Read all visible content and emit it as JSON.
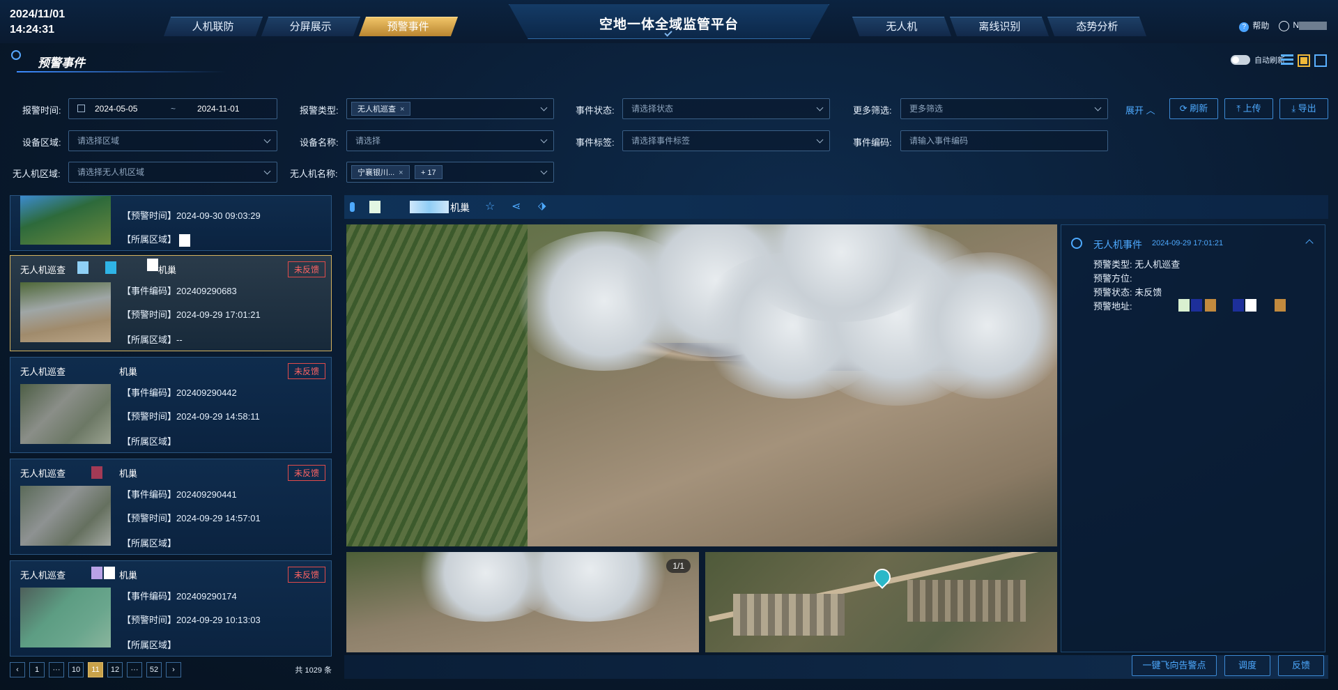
{
  "header": {
    "date": "2024/11/01",
    "time": "14:24:31",
    "title": "空地一体全域监管平台",
    "tabs_left": [
      {
        "label": "人机联防"
      },
      {
        "label": "分屏展示"
      },
      {
        "label": "预警事件",
        "active": true
      }
    ],
    "tabs_right": [
      {
        "label": "无人机"
      },
      {
        "label": "离线识别"
      },
      {
        "label": "态势分析"
      }
    ],
    "help": "帮助",
    "user": "N"
  },
  "page": {
    "title": "预警事件",
    "auto_refresh_label": "自动刷新"
  },
  "filters": {
    "alarm_time_label": "报警时间:",
    "date_start": "2024-05-05",
    "date_sep": "~",
    "date_end": "2024-11-01",
    "alarm_type_label": "报警类型:",
    "alarm_type_tag": "无人机巡查",
    "event_status_label": "事件状态:",
    "event_status_placeholder": "请选择状态",
    "more_label": "更多筛选:",
    "more_placeholder": "更多筛选",
    "expand": "展开",
    "refresh": "刷新",
    "upload": "上传",
    "export": "导出",
    "device_area_label": "设备区域:",
    "device_area_placeholder": "请选择区域",
    "device_name_label": "设备名称:",
    "device_name_placeholder": "请选择",
    "event_tag_label": "事件标签:",
    "event_tag_placeholder": "请选择事件标签",
    "event_code_label": "事件编码:",
    "event_code_placeholder": "请输入事件编码",
    "uav_area_label": "无人机区域:",
    "uav_area_placeholder": "请选择无人机区域",
    "uav_name_label": "无人机名称:",
    "uav_name_tag": "宁襄银川...",
    "uav_name_more": "+ 17"
  },
  "list": {
    "partial": {
      "time_line": "【预警时间】2024-09-30 09:03:29",
      "area_line": "【所属区域】"
    },
    "cards": [
      {
        "type": "无人机巡查",
        "tail": "机巢",
        "status": "未反馈",
        "code_line": "【事件编码】202409290683",
        "time_line": "【预警时间】2024-09-29 17:01:21",
        "area_line": "【所属区域】--"
      },
      {
        "type": "无人机巡查",
        "tail": "机巢",
        "status": "未反馈",
        "code_line": "【事件编码】202409290442",
        "time_line": "【预警时间】2024-09-29 14:58:11",
        "area_line": "【所属区域】"
      },
      {
        "type": "无人机巡查",
        "tail": "机巢",
        "status": "未反馈",
        "code_line": "【事件编码】202409290441",
        "time_line": "【预警时间】2024-09-29 14:57:01",
        "area_line": "【所属区域】"
      },
      {
        "type": "无人机巡查",
        "tail": "机巢",
        "status": "未反馈",
        "code_line": "【事件编码】202409290174",
        "time_line": "【预警时间】2024-09-29 10:13:03",
        "area_line": "【所属区域】"
      }
    ]
  },
  "pager": {
    "pages": [
      "1",
      "···",
      "10",
      "11",
      "12",
      "···",
      "52"
    ],
    "current": "11",
    "total": "共 1029 条"
  },
  "detail": {
    "toolbar_title": "机巢",
    "image_counter": "1/1",
    "event_title": "无人机事件",
    "event_time": "2024-09-29 17:01:21",
    "type_line": "预警类型:  无人机巡查",
    "position_line": "预警方位:",
    "status_line": "预警状态:  未反馈",
    "address_line": "预警地址:",
    "fly_btn": "一键飞向告警点",
    "dispatch_btn": "调度",
    "feedback_btn": "反馈"
  },
  "colors": {
    "accent": "#4eaaff",
    "active_tab": "#d6a04a",
    "alert": "#ff6464",
    "selected_border": "#d6b35e"
  }
}
